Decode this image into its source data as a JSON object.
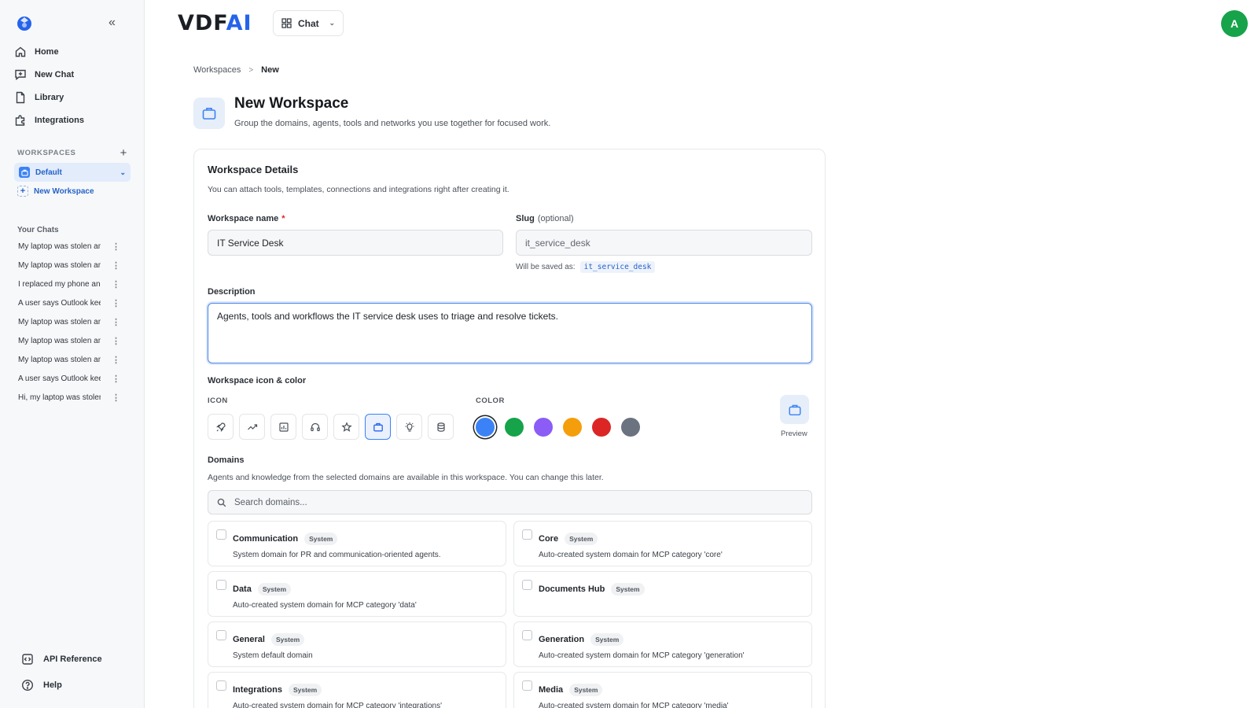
{
  "app": {
    "logo_main": "VDF",
    "logo_accent": "AI",
    "mode": "Chat",
    "avatar_initial": "A"
  },
  "sidebar": {
    "nav": [
      {
        "label": "Home",
        "icon": "home-icon"
      },
      {
        "label": "New Chat",
        "icon": "new-chat-icon"
      },
      {
        "label": "Library",
        "icon": "file-icon"
      },
      {
        "label": "Integrations",
        "icon": "puzzle-icon"
      }
    ],
    "workspaces_heading": "WORKSPACES",
    "workspaces": [
      {
        "label": "Default",
        "active": true
      }
    ],
    "new_workspace": "New Workspace",
    "chats_heading": "Your Chats",
    "chats": [
      "My laptop was stolen and I need help",
      "My laptop was stolen and I need help",
      "I replaced my phone and need help",
      "A user says Outlook keeps crashing",
      "My laptop was stolen and I need help",
      "My laptop was stolen and I need help",
      "My laptop was stolen and I need help",
      "A user says Outlook keeps crashing",
      "Hi, my laptop was stolen"
    ],
    "bottom": [
      {
        "label": "API Reference",
        "icon": "api-icon"
      },
      {
        "label": "Help",
        "icon": "help-icon"
      }
    ]
  },
  "breadcrumb": {
    "parent": "Workspaces",
    "separator": ">",
    "current": "New"
  },
  "header": {
    "title": "New Workspace",
    "subtitle": "Group the domains, agents, tools and networks you use together for focused work."
  },
  "form": {
    "section_title": "Workspace Details",
    "section_sub": "You can attach tools, templates, connections and integrations right after creating it.",
    "name_label": "Workspace name",
    "name_required": "*",
    "name_value": "IT Service Desk",
    "slug_label": "Slug",
    "slug_optional": "(optional)",
    "slug_placeholder": "it_service_desk",
    "saved_as_label": "Will be saved as:",
    "saved_as_value": "it_service_desk",
    "description_label": "Description",
    "description_value": "Agents, tools and workflows the IT service desk uses to triage and resolve tickets.",
    "icon_color_label": "Workspace icon & color",
    "icon_label": "ICON",
    "color_label": "COLOR",
    "icons": [
      "rocket-icon",
      "trending-icon",
      "chart-icon",
      "headset-icon",
      "star-icon",
      "briefcase-icon",
      "lightbulb-icon",
      "database-icon"
    ],
    "selected_icon": "briefcase-icon",
    "colors": [
      "#3b82f6",
      "#16a34a",
      "#8b5cf6",
      "#f59e0b",
      "#dc2626",
      "#6b7280"
    ],
    "selected_color": "#3b82f6",
    "preview_label": "Preview",
    "domains_label": "Domains",
    "domains_sub": "Agents and knowledge from the selected domains are available in this workspace. You can change this later.",
    "domains_search_placeholder": "Search domains...",
    "domains": [
      {
        "name": "Communication",
        "badge": "System",
        "desc": "System domain for PR and communication-oriented agents."
      },
      {
        "name": "Core",
        "badge": "System",
        "desc": "Auto-created system domain for MCP category 'core'"
      },
      {
        "name": "Data",
        "badge": "System",
        "desc": "Auto-created system domain for MCP category 'data'"
      },
      {
        "name": "Documents Hub",
        "badge": "System",
        "desc": ""
      },
      {
        "name": "General",
        "badge": "System",
        "desc": "System default domain"
      },
      {
        "name": "Generation",
        "badge": "System",
        "desc": "Auto-created system domain for MCP category 'generation'"
      },
      {
        "name": "Integrations",
        "badge": "System",
        "desc": "Auto-created system domain for MCP category 'integrations'"
      },
      {
        "name": "Media",
        "badge": "System",
        "desc": "Auto-created system domain for MCP category 'media'"
      }
    ]
  }
}
